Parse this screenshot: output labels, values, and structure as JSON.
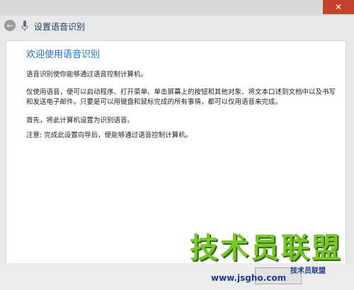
{
  "titlebar": {
    "close_label": "✕"
  },
  "header": {
    "back_glyph": "←",
    "title": "设置语音识别"
  },
  "content": {
    "heading": "欢迎使用语音识别",
    "paragraphs": [
      "语音识别使你能够通过语音控制计算机。",
      "仅使用语音，便可以启动程序、打开菜单、单击屏幕上的按钮和其他对象、将文本口述到文档中以及书写和发送电子邮件。只要是可以用键盘和鼠标完成的所有事情，都可以仅用语音来完成。",
      "首先，将此计算机设置为识别语音。",
      "注意: 完成此设置向导后，便能够通过语音控制计算机。"
    ]
  },
  "watermark": {
    "text": "技术员联盟",
    "url": "www.jsgho.com",
    "logo": "技术员联盟"
  },
  "colors": {
    "heading": "#1f6fbf",
    "close": "#c7402b",
    "watermark": "#7ac52a"
  }
}
